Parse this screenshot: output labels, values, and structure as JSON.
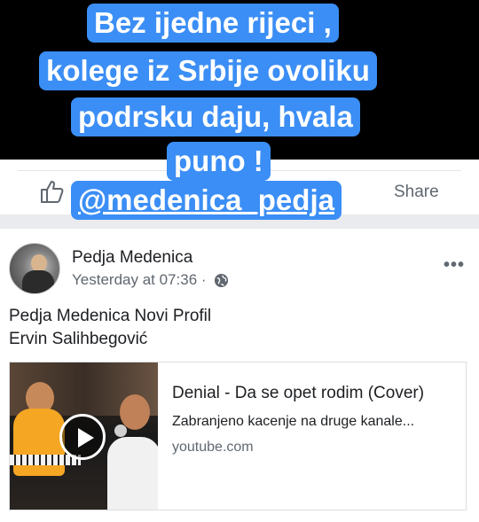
{
  "story_caption": {
    "lines": [
      "Bez ijedne rijeci ,",
      "kolege iz Srbije ovoliku",
      "podrsku daju, hvala",
      "puno !"
    ],
    "mention": "@medenica_pedja",
    "bg_color": "#3b8ef5"
  },
  "action_bar": {
    "like_icon": "thumbs-up-icon",
    "share_label": "Share"
  },
  "post": {
    "author": "Pedja Medenica",
    "timestamp": "Yesterday at 07:36 ·",
    "privacy_icon": "globe-icon",
    "more_icon": "more-options-icon",
    "more_glyph": "•••",
    "text_lines": [
      "Pedja Medenica Novi Profil",
      "Ervin Salihbegović"
    ],
    "link": {
      "title": "Denial - Da se opet rodim (Cover)",
      "description": "Zabranjeno kacenje na druge kanale...",
      "domain": "youtube.com",
      "play_icon": "play-icon"
    }
  }
}
